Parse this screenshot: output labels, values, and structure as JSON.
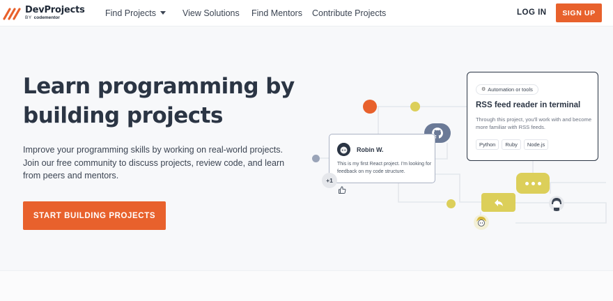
{
  "brand": {
    "name": "DevProjects",
    "by": "BY",
    "company": "codementor",
    "accent": "#e8612c"
  },
  "nav": {
    "links": [
      "Find Projects",
      "View Solutions",
      "Find Mentors",
      "Contribute Projects"
    ],
    "login": "LOG IN",
    "signup": "SIGN UP"
  },
  "hero": {
    "title": "Learn programming by building projects",
    "subtitle": "Improve your programming skills by working on real-world projects. Join our free community to discuss projects, review code, and learn from peers and mentors.",
    "cta": "START BUILDING PROJECTS"
  },
  "feature_card": {
    "tag": "Automation or tools",
    "title": "RSS feed reader in terminal",
    "description": "Through this project, you'll work with and become more familiar with RSS feeds.",
    "chips": [
      "Python",
      "Ruby",
      "Node.js"
    ]
  },
  "comment_card": {
    "name": "Robin W.",
    "text": "This is my first React project. I'm looking for feedback on my code structure.",
    "plus_one": "+1"
  },
  "colors": {
    "dot_orange": "#e8612c",
    "dot_yellow": "#dccf5a",
    "dot_slate": "#9aa4b8",
    "bubble_slate": "#6b7a97"
  }
}
